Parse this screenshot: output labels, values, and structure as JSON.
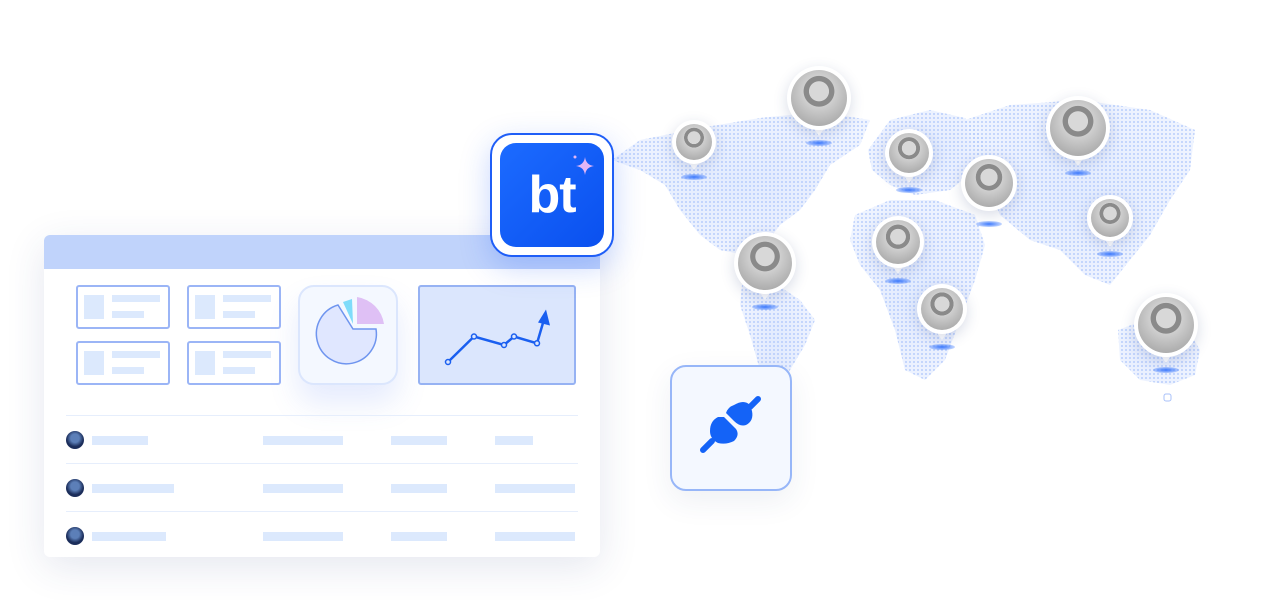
{
  "logo": {
    "text": "bt",
    "bg_color": "#1563ff",
    "sparkle_color": "#d9a8f5"
  },
  "dashboard": {
    "header_color": "#c0d3fb",
    "pie": {
      "slices": [
        {
          "color": "#e0e7ff"
        },
        {
          "color": "#7fdcfa"
        },
        {
          "color": "#dfc0f5"
        }
      ]
    },
    "trend": {
      "points": [
        1,
        4,
        3,
        4,
        3.2,
        6
      ],
      "color": "#1a5ff0"
    },
    "rows": 3
  },
  "icons": {
    "plug": "plug-connect-icon",
    "sparkle": "sparkle-icon"
  },
  "map": {
    "dot_color": "#b9cdfb",
    "pins": 10
  }
}
